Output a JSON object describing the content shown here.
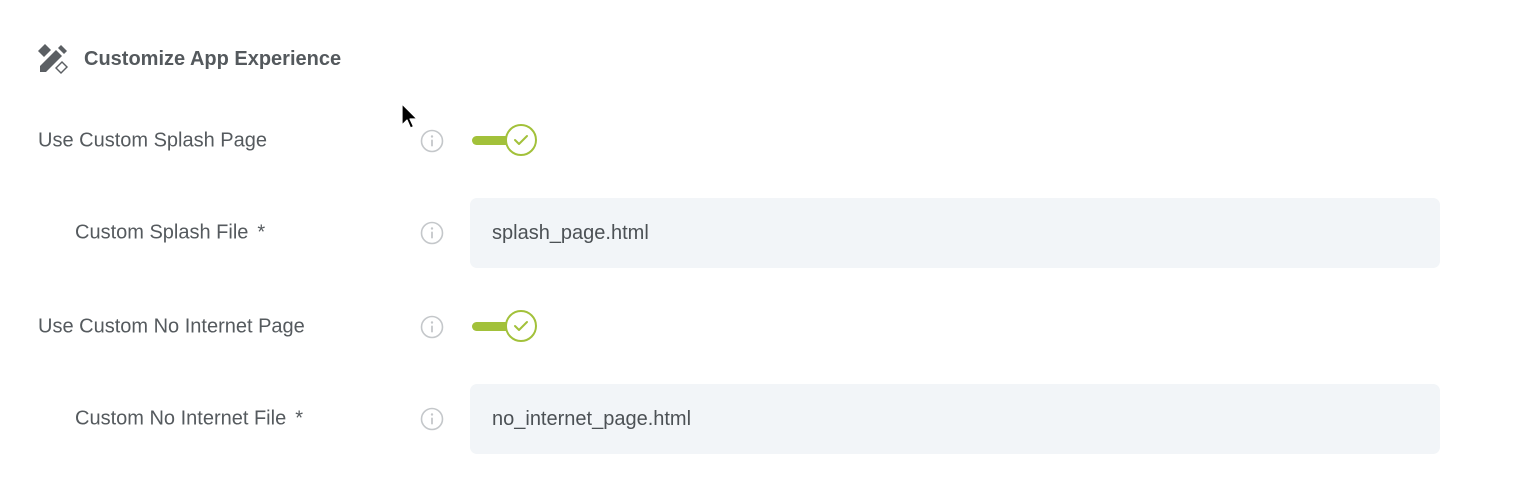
{
  "section": {
    "title": "Customize App Experience",
    "icon": "edit-design-icon"
  },
  "rows": [
    {
      "label": "Use Custom Splash Page",
      "type": "toggle",
      "on": true
    },
    {
      "label": "Custom Splash File",
      "required_mark": "*",
      "type": "text",
      "value": "splash_page.html"
    },
    {
      "label": "Use Custom No Internet Page",
      "type": "toggle",
      "on": true
    },
    {
      "label": "Custom No Internet File",
      "required_mark": "*",
      "type": "text",
      "value": "no_internet_page.html"
    }
  ],
  "colors": {
    "accent": "#a2c13a",
    "field_bg": "#f2f5f8",
    "text": "#555a5e",
    "icon": "#c4c7ca"
  }
}
